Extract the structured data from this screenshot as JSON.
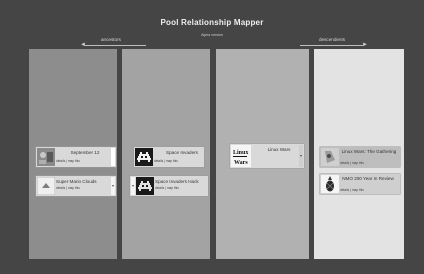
{
  "app": {
    "title": "Pool Relationship Mapper",
    "version_label": "Alpha version"
  },
  "nav": {
    "ancestors": "ancestors",
    "descendents": "descendents"
  },
  "card_links": "details | map this",
  "columns": [
    {
      "cards": [
        {
          "name": "September 12",
          "icon": "photo-thumb-icon"
        },
        {
          "name": "Super Mario Clouds",
          "icon": "cloud-thumb-icon"
        }
      ]
    },
    {
      "cards": [
        {
          "name": "Space Invaders",
          "icon": "space-invader-icon"
        },
        {
          "name": "Space Invaders Hack",
          "icon": "space-invader-icon"
        }
      ]
    },
    {
      "cards": [
        {
          "name": "Linux Wars",
          "icon": "linux-wars-thumb-icon",
          "thumb_text": "Linux Wars"
        }
      ]
    },
    {
      "cards": [
        {
          "name": "Linux Wars: The Gathering",
          "icon": "gathering-thumb-icon"
        },
        {
          "name": "NMO 200 Year In Review",
          "icon": "pineapple-thumb-icon"
        }
      ]
    }
  ]
}
